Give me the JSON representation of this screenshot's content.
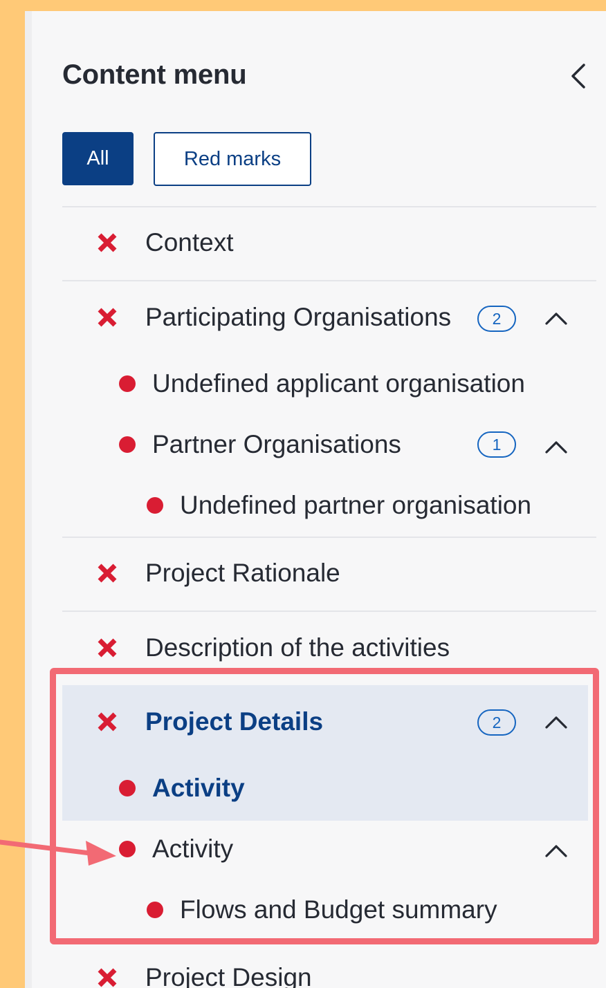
{
  "menu": {
    "title": "Content menu",
    "collapse_icon": "chevron-left-icon"
  },
  "filters": {
    "all_label": "All",
    "red_marks_label": "Red marks",
    "selected": "All"
  },
  "items": {
    "context": "Context",
    "participating": "Participating Organisations",
    "participating_badge": "2",
    "undefined_applicant": "Undefined applicant organisation",
    "partner_orgs": "Partner Organisations",
    "partner_badge": "1",
    "undefined_partner": "Undefined partner organisation",
    "project_rationale": "Project Rationale",
    "description_activities": "Description of the activities",
    "project_details": "Project Details",
    "project_details_badge": "2",
    "activity_selected": "Activity",
    "activity": "Activity",
    "flows_budget": "Flows and Budget summary",
    "project_design": "Project Design"
  },
  "colors": {
    "page_background": "#FFC977",
    "panel_background": "#F7F7F8",
    "primary_blue": "#0B3F84",
    "badge_blue": "#1565C0",
    "error_red": "#D91D33",
    "highlight_box": "#F26A74",
    "selected_row": "#E4E9F2"
  },
  "icons": {
    "error_mark": "x-mark-icon",
    "bullet": "red-dot-icon",
    "expand": "chevron-up-icon"
  }
}
